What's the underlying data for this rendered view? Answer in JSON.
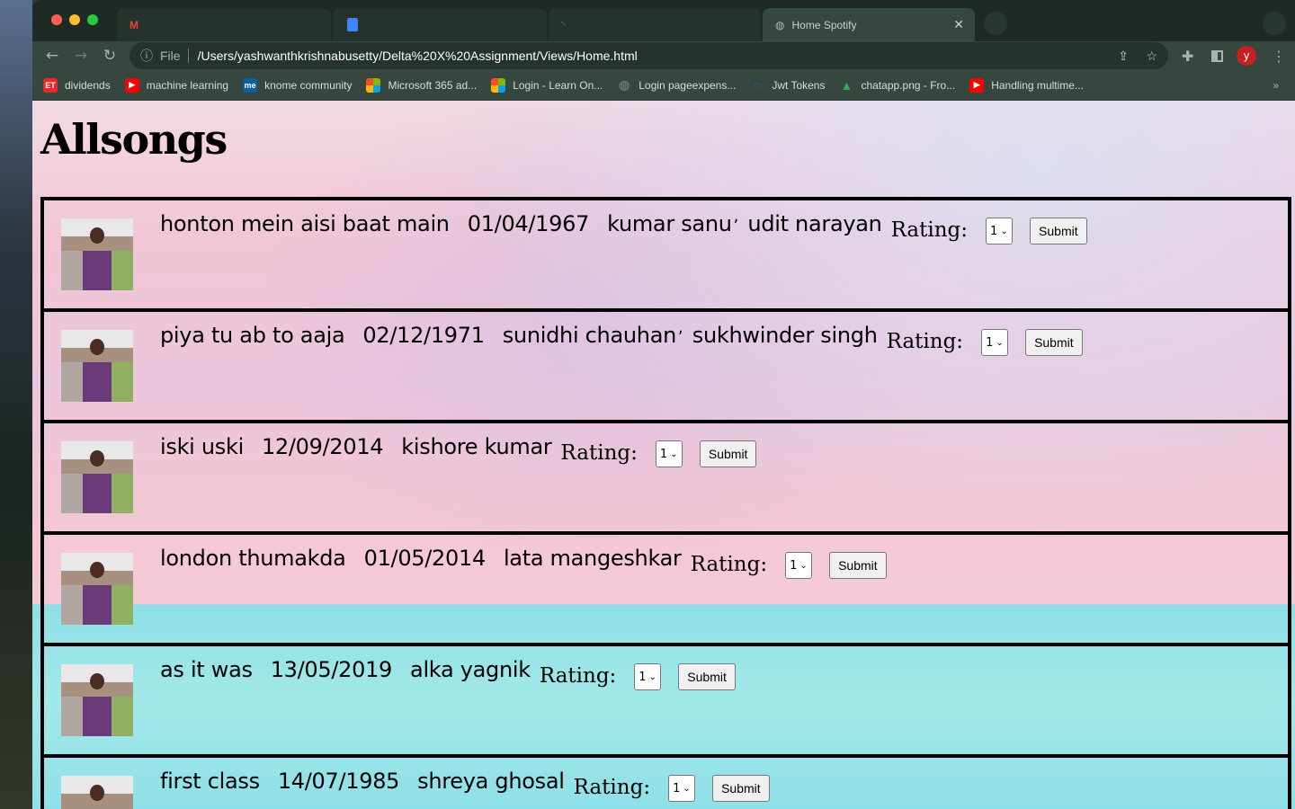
{
  "browser": {
    "tabs": [
      {
        "label": "",
        "icon": "gmail-icon"
      },
      {
        "label": "",
        "icon": "docs-icon"
      },
      {
        "label": "",
        "icon": "loading-icon"
      },
      {
        "label": "Home Spotify",
        "icon": "globe-icon",
        "active": true
      }
    ],
    "url_prefix": "File",
    "url": "/Users/yashwanthkrishnabusetty/Delta%20X%20Assignment/Views/Home.html",
    "profile_initial": "y",
    "bookmarks": [
      {
        "label": "dividends",
        "icon": "ET",
        "color": "#e8262c"
      },
      {
        "label": "machine learning",
        "icon": "▶",
        "color": "#ff0000"
      },
      {
        "label": "knome community",
        "icon": "me",
        "color": "#0a5f9e"
      },
      {
        "label": "Microsoft 365 ad...",
        "icon": "",
        "color": "#f25022"
      },
      {
        "label": "Login - Learn On...",
        "icon": "",
        "color": "#1e6fd9"
      },
      {
        "label": "Login pageexpens...",
        "icon": "◍",
        "color": "#6b7570"
      },
      {
        "label": "Jwt Tokens",
        "icon": "◌",
        "color": "#1a73e8"
      },
      {
        "label": "chatapp.png - Fro...",
        "icon": "▲",
        "color": "#34a853"
      },
      {
        "label": "Handling multime...",
        "icon": "▶",
        "color": "#ff0000"
      }
    ],
    "more": "»"
  },
  "page": {
    "title": "Allsongs",
    "rating_label": "Rating:",
    "submit_label": "Submit",
    "songs": [
      {
        "title": "honton mein aisi baat main",
        "date": "01/04/1967",
        "artists": [
          "kumar sanu",
          "udit narayan"
        ],
        "rating": "1"
      },
      {
        "title": "piya tu ab to aaja",
        "date": "02/12/1971",
        "artists": [
          "sunidhi chauhan",
          "sukhwinder singh"
        ],
        "rating": "1"
      },
      {
        "title": "iski uski",
        "date": "12/09/2014",
        "artists": [
          "kishore kumar"
        ],
        "rating": "1"
      },
      {
        "title": "london thumakda",
        "date": "01/05/2014",
        "artists": [
          "lata mangeshkar"
        ],
        "rating": "1"
      },
      {
        "title": "as it was",
        "date": "13/05/2019",
        "artists": [
          "alka yagnik"
        ],
        "rating": "1"
      },
      {
        "title": "first class",
        "date": "14/07/1985",
        "artists": [
          "shreya ghosal"
        ],
        "rating": "1"
      }
    ]
  }
}
